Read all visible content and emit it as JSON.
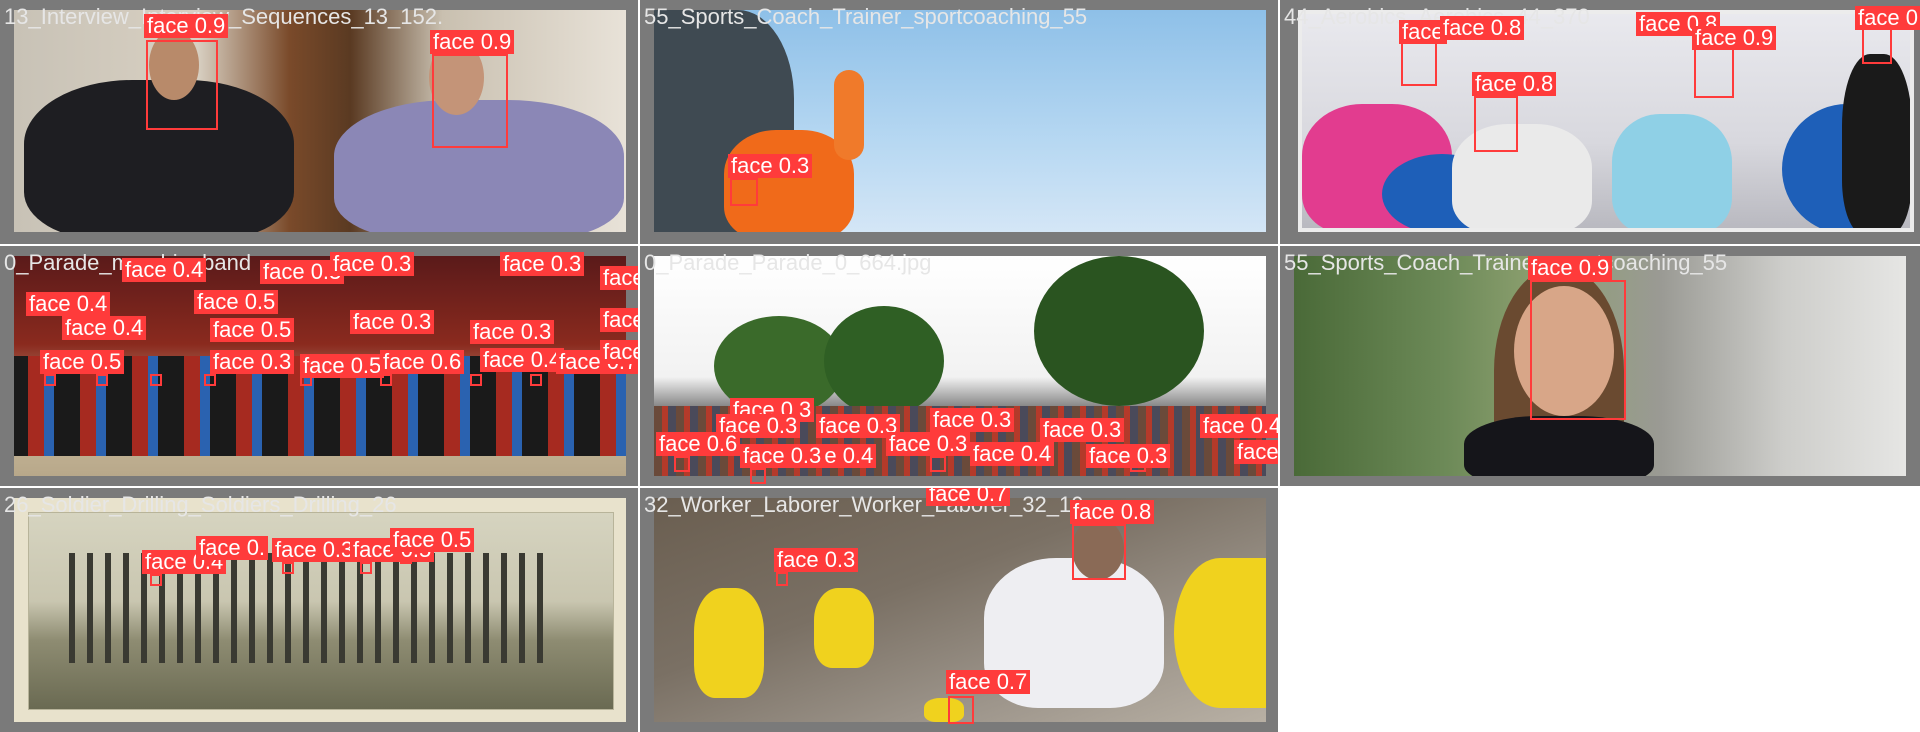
{
  "grid": {
    "tiles": [
      {
        "caption": "13_Interview_Interview_Sequences_13_152.",
        "detections": [
          {
            "label": "face 0.9"
          },
          {
            "label": "face 0.9"
          }
        ]
      },
      {
        "caption": "55_Sports_Coach_Trainer_sportcoaching_55",
        "detections": [
          {
            "label": "face 0.3"
          }
        ]
      },
      {
        "caption": "44_Aerobics_Aerobics_44_370",
        "detections": [
          {
            "label": "face"
          },
          {
            "label": "face 0.8"
          },
          {
            "label": "face 0.8"
          },
          {
            "label": "face 0.8"
          },
          {
            "label": "face 0.9"
          },
          {
            "label": "face 0"
          }
        ]
      },
      {
        "caption": "0_Parade_marchingband",
        "detections": [
          {
            "label": "face 0.4"
          },
          {
            "label": "face 0.3"
          },
          {
            "label": "face 0.3"
          },
          {
            "label": "face 0.3"
          },
          {
            "label": "face 0.4"
          },
          {
            "label": "face 0.5"
          },
          {
            "label": "face 0.3"
          },
          {
            "label": "face 0.4"
          },
          {
            "label": "face 0.5"
          },
          {
            "label": "face 0.3"
          },
          {
            "label": "face 0.3"
          },
          {
            "label": "face 0.5"
          },
          {
            "label": "face 0.5"
          },
          {
            "label": "face 0.3"
          },
          {
            "label": "face 0.5"
          },
          {
            "label": "face 0.6"
          },
          {
            "label": "face 0.4"
          },
          {
            "label": "face 0.7"
          },
          {
            "label": "face 0.7"
          }
        ]
      },
      {
        "caption": "0_Parade_Parade_0_664.jpg",
        "detections": [
          {
            "label": "face 0.3"
          },
          {
            "label": "face 0.3"
          },
          {
            "label": "face 0.3"
          },
          {
            "label": "face 0.3"
          },
          {
            "label": "face 0.3"
          },
          {
            "label": "face 0.4"
          },
          {
            "label": "face 0.3"
          },
          {
            "label": "face 0.4"
          },
          {
            "label": "face 0.6"
          },
          {
            "label": "face 0.3"
          },
          {
            "label": "face 0.4"
          },
          {
            "label": "face 0.3"
          },
          {
            "label": "face 0.3"
          },
          {
            "label": "face 0.7"
          }
        ]
      },
      {
        "caption": "55_Sports_Coach_Trainer_sportcoaching_55",
        "detections": [
          {
            "label": "face 0.9"
          }
        ]
      },
      {
        "caption": "26_Soldier_Drilling_Soldiers_Drilling_26",
        "detections": [
          {
            "label": "face 0.4"
          },
          {
            "label": "face 0."
          },
          {
            "label": "face 0.3"
          },
          {
            "label": "face 0.5"
          },
          {
            "label": "face 0.5"
          }
        ]
      },
      {
        "caption": "32_Worker_Laborer_Worker_Laborer_32_10",
        "detections": [
          {
            "label": "face 0.8"
          },
          {
            "label": "face 0.3"
          },
          {
            "label": "face 0.7"
          }
        ]
      }
    ]
  },
  "colors": {
    "box": "#ff3b3b",
    "label_text": "#ffffff",
    "caption_text": "#e6e6e6",
    "tile_border": "#7a7a7a"
  }
}
